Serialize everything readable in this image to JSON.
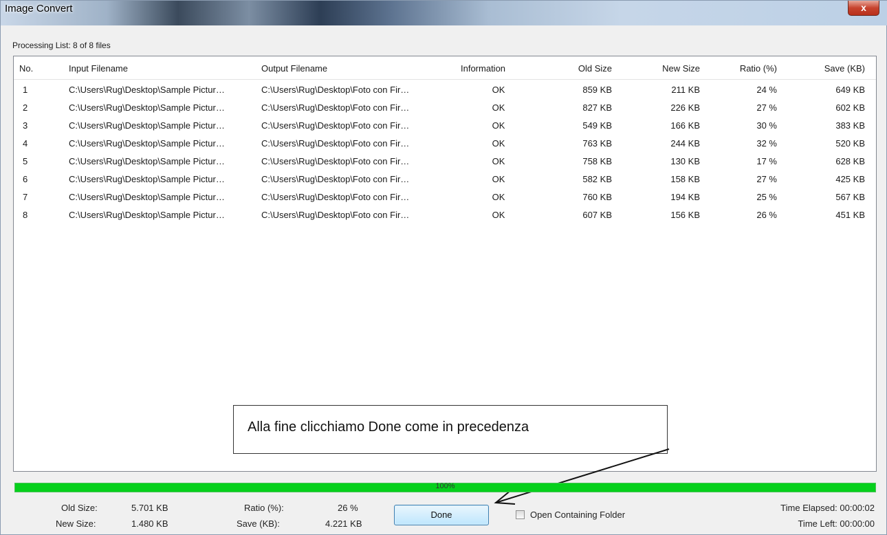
{
  "window": {
    "title": "Image Convert",
    "close_glyph": "x"
  },
  "processing_list": "Processing List: 8 of 8 files",
  "columns": {
    "no": "No.",
    "input": "Input Filename",
    "output": "Output Filename",
    "info": "Information",
    "old": "Old Size",
    "new": "New Size",
    "ratio": "Ratio (%)",
    "save": "Save (KB)"
  },
  "rows": [
    {
      "no": "1",
      "input": "C:\\Users\\Rug\\Desktop\\Sample Pictur…",
      "output": "C:\\Users\\Rug\\Desktop\\Foto con Fir…",
      "info": "OK",
      "old": "859 KB",
      "new": "211 KB",
      "ratio": "24 %",
      "save": "649 KB"
    },
    {
      "no": "2",
      "input": "C:\\Users\\Rug\\Desktop\\Sample Pictur…",
      "output": "C:\\Users\\Rug\\Desktop\\Foto con Fir…",
      "info": "OK",
      "old": "827 KB",
      "new": "226 KB",
      "ratio": "27 %",
      "save": "602 KB"
    },
    {
      "no": "3",
      "input": "C:\\Users\\Rug\\Desktop\\Sample Pictur…",
      "output": "C:\\Users\\Rug\\Desktop\\Foto con Fir…",
      "info": "OK",
      "old": "549 KB",
      "new": "166 KB",
      "ratio": "30 %",
      "save": "383 KB"
    },
    {
      "no": "4",
      "input": "C:\\Users\\Rug\\Desktop\\Sample Pictur…",
      "output": "C:\\Users\\Rug\\Desktop\\Foto con Fir…",
      "info": "OK",
      "old": "763 KB",
      "new": "244 KB",
      "ratio": "32 %",
      "save": "520 KB"
    },
    {
      "no": "5",
      "input": "C:\\Users\\Rug\\Desktop\\Sample Pictur…",
      "output": "C:\\Users\\Rug\\Desktop\\Foto con Fir…",
      "info": "OK",
      "old": "758 KB",
      "new": "130 KB",
      "ratio": "17 %",
      "save": "628 KB"
    },
    {
      "no": "6",
      "input": "C:\\Users\\Rug\\Desktop\\Sample Pictur…",
      "output": "C:\\Users\\Rug\\Desktop\\Foto con Fir…",
      "info": "OK",
      "old": "582 KB",
      "new": "158 KB",
      "ratio": "27 %",
      "save": "425 KB"
    },
    {
      "no": "7",
      "input": "C:\\Users\\Rug\\Desktop\\Sample Pictur…",
      "output": "C:\\Users\\Rug\\Desktop\\Foto con Fir…",
      "info": "OK",
      "old": "760 KB",
      "new": "194 KB",
      "ratio": "25 %",
      "save": "567 KB"
    },
    {
      "no": "8",
      "input": "C:\\Users\\Rug\\Desktop\\Sample Pictur…",
      "output": "C:\\Users\\Rug\\Desktop\\Foto con Fir…",
      "info": "OK",
      "old": "607 KB",
      "new": "156 KB",
      "ratio": "26 %",
      "save": "451 KB"
    }
  ],
  "callout": "Alla fine clicchiamo Done come in precedenza",
  "progress": {
    "label": "100%",
    "value": 1.0,
    "color": "#06d01c"
  },
  "summary": {
    "old_size_label": "Old Size:",
    "old_size": "5.701 KB",
    "new_size_label": "New Size:",
    "new_size": "1.480 KB",
    "ratio_label": "Ratio (%):",
    "ratio": "26 %",
    "save_label": "Save (KB):",
    "save": "4.221 KB",
    "time_elapsed": "Time Elapsed: 00:00:02",
    "time_left": "Time Left: 00:00:00"
  },
  "done_button": "Done",
  "open_folder_label": "Open Containing Folder",
  "open_folder_checked": false
}
